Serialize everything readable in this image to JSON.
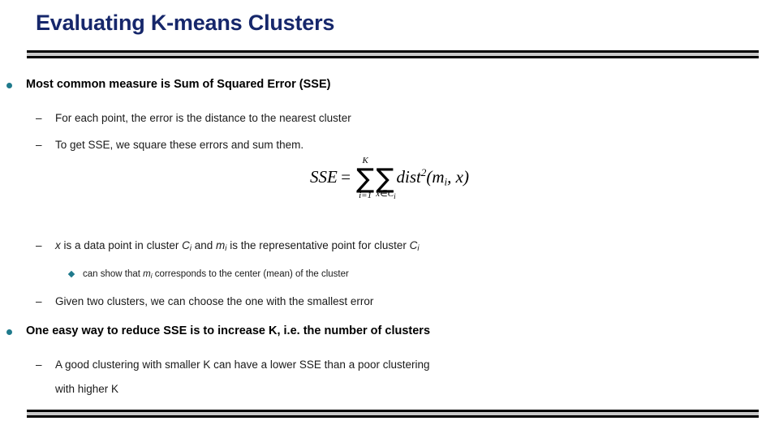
{
  "slide": {
    "title": "Evaluating K-means Clusters",
    "title_color": "#16276B",
    "bullet_color": "#1F7A8C",
    "divider_fill": "#c9c9c9",
    "divider_border": "#000000",
    "background": "#ffffff"
  },
  "content": {
    "b1": "Most common measure is Sum of Squared Error (SSE)",
    "b1s1": "For each point, the error is the distance to the nearest cluster",
    "b1s2": "To get SSE, we square these errors and sum them.",
    "b1s3_pre": "x",
    "b1s3_a": " is a data point in cluster ",
    "b1s3_c1": "C",
    "b1s3_c1sub": "i",
    "b1s3_b": " and ",
    "b1s3_m": "m",
    "b1s3_msub": "i",
    "b1s3_c": " is the representative point for cluster ",
    "b1s3_c2": "C",
    "b1s3_c2sub": "i",
    "b1s3s1_a": "can show that ",
    "b1s3s1_m": "m",
    "b1s3s1_msub": "i",
    "b1s3s1_b": " corresponds to the center (mean) of the cluster",
    "b1s4": "Given two clusters, we can choose the one with the smallest error",
    "b2": "One easy way to reduce SSE is to increase K, i.e. the number of clusters",
    "b2s1": "A good clustering with smaller K can have a lower SSE than a poor clustering",
    "b2s1_cont": "with higher K"
  },
  "formula": {
    "lhs": "SSE",
    "equals": "=",
    "sigma_glyph": "∑",
    "sigma1_upper": "K",
    "sigma1_lower": "i=1",
    "sigma2_lower_x": "x",
    "sigma2_lower_in": "∈",
    "sigma2_lower_c": "C",
    "sigma2_lower_csub": "i",
    "fn": "dist",
    "power": "2",
    "open": "(",
    "arg_m": "m",
    "arg_msub": "i",
    "comma": ", ",
    "arg_x": "x",
    "close": ")"
  },
  "icons": {
    "bullet_round": "round-bullet-icon",
    "bullet_dash": "dash-bullet-icon",
    "bullet_diamond": "diamond-bullet-icon",
    "dash_glyph": "–"
  }
}
